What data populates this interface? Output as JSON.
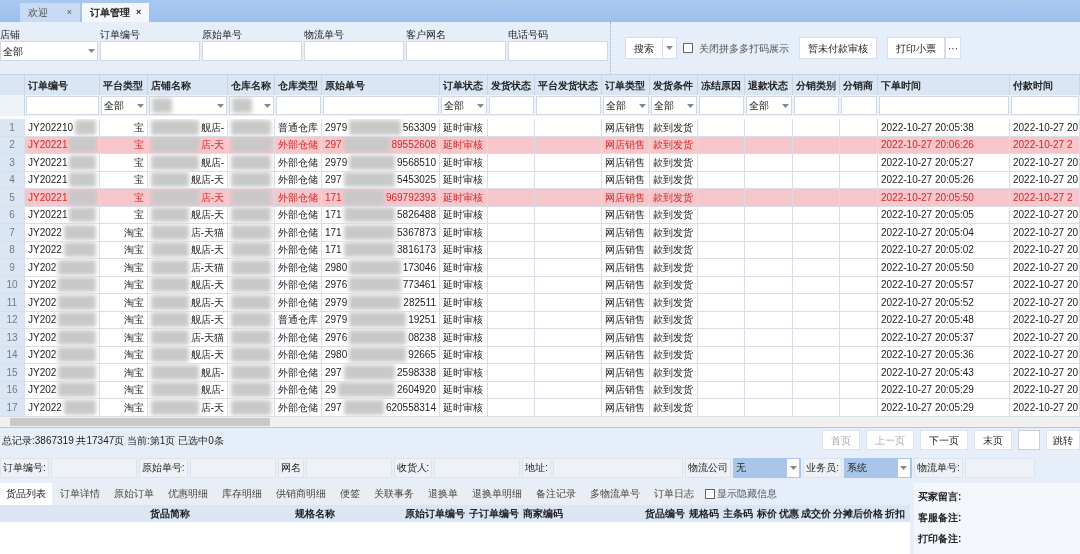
{
  "tabs": [
    {
      "label": "欢迎",
      "close": "×",
      "selected": false
    },
    {
      "label": "订单管理",
      "close": "×",
      "selected": true
    }
  ],
  "search": {
    "fields": [
      {
        "label": "店铺",
        "value": "全部",
        "kind": "select"
      },
      {
        "label": "订单编号",
        "kind": "text"
      },
      {
        "label": "原始单号",
        "kind": "text"
      },
      {
        "label": "物流单号",
        "kind": "text"
      },
      {
        "label": "客户网名",
        "kind": "text"
      },
      {
        "label": "电话号码",
        "kind": "text"
      }
    ],
    "search_button": "搜索",
    "checkbox": {
      "label": "关闭拼多多打码展示",
      "checked": false
    },
    "buttons": [
      "暂未付款审核",
      "打印小票"
    ],
    "more": "···"
  },
  "grid": {
    "columns": [
      {
        "label": "订单编号",
        "filter": {
          "kind": "text"
        }
      },
      {
        "label": "平台类型",
        "filter": {
          "kind": "select",
          "value": "全部"
        }
      },
      {
        "label": "店铺名称",
        "filter": {
          "kind": "select"
        }
      },
      {
        "label": "仓库名称",
        "filter": {
          "kind": "select"
        }
      },
      {
        "label": "仓库类型",
        "filter": {
          "kind": "text"
        }
      },
      {
        "label": "原始单号",
        "filter": {
          "kind": "text"
        }
      },
      {
        "label": "订单状态",
        "filter": {
          "kind": "select",
          "value": "全部"
        }
      },
      {
        "label": "发货状态",
        "filter": {
          "kind": "text"
        }
      },
      {
        "label": "平台发货状态",
        "filter": {
          "kind": "text"
        }
      },
      {
        "label": "订单类型",
        "filter": {
          "kind": "select",
          "value": "全部"
        }
      },
      {
        "label": "发货条件",
        "filter": {
          "kind": "select",
          "value": "全部"
        }
      },
      {
        "label": "冻结原因",
        "filter": {
          "kind": "text"
        }
      },
      {
        "label": "退款状态",
        "filter": {
          "kind": "select",
          "value": "全部"
        }
      },
      {
        "label": "分销类别",
        "filter": {
          "kind": "text"
        }
      },
      {
        "label": "分销商",
        "filter": {
          "kind": "text"
        }
      },
      {
        "label": "下单时间",
        "filter": {
          "kind": "text"
        }
      },
      {
        "label": "付款时间",
        "filter": {
          "kind": "text"
        }
      }
    ],
    "rows": [
      {
        "index": "1",
        "order_no": "JY202210",
        "platform": "宝",
        "shop": "舰店-",
        "warehouse_type": "普通仓库",
        "orig_a": "2979",
        "orig_b": "563309",
        "status": "延时审核",
        "order_type": "网店销售",
        "condition": "款到发货",
        "order_time": "2022-10-27 20:05:38",
        "pay_time": "2022-10-27 20",
        "highlighted": false
      },
      {
        "index": "2",
        "order_no": "JY20221",
        "platform": "宝",
        "shop": "店-天",
        "warehouse_type": "外部仓储",
        "orig_a": "297",
        "orig_b": "89552608",
        "status": "延时审核",
        "order_type": "网店销售",
        "condition": "款到发货",
        "order_time": "2022-10-27 20:06:26",
        "pay_time": "2022-10-27 2",
        "highlighted": true
      },
      {
        "index": "3",
        "order_no": "JY20221",
        "platform": "宝",
        "shop": "舰店-",
        "warehouse_type": "外部仓储",
        "orig_a": "2979",
        "orig_b": "9568510",
        "status": "延时审核",
        "order_type": "网店销售",
        "condition": "款到发货",
        "order_time": "2022-10-27 20:05:27",
        "pay_time": "2022-10-27 20",
        "highlighted": false
      },
      {
        "index": "4",
        "order_no": "JY20221",
        "platform": "宝",
        "shop": "舰店-天",
        "warehouse_type": "外部仓储",
        "orig_a": "297",
        "orig_b": "5453025",
        "status": "延时审核",
        "order_type": "网店销售",
        "condition": "款到发货",
        "order_time": "2022-10-27 20:05:26",
        "pay_time": "2022-10-27 20",
        "highlighted": false
      },
      {
        "index": "5",
        "order_no": "JY20221",
        "platform": "宝",
        "shop": "店-天",
        "warehouse_type": "外部仓储",
        "orig_a": "171",
        "orig_b": "969792393",
        "status": "延时审核",
        "order_type": "网店销售",
        "condition": "款到发货",
        "order_time": "2022-10-27 20:05:50",
        "pay_time": "2022-10-27 2",
        "highlighted": true
      },
      {
        "index": "6",
        "order_no": "JY20221",
        "platform": "宝",
        "shop": "舰店-天",
        "warehouse_type": "外部仓储",
        "orig_a": "171",
        "orig_b": "5826488",
        "status": "延时审核",
        "order_type": "网店销售",
        "condition": "款到发货",
        "order_time": "2022-10-27 20:05:05",
        "pay_time": "2022-10-27 20",
        "highlighted": false
      },
      {
        "index": "7",
        "order_no": "JY2022",
        "platform": "淘宝",
        "shop": "店-天猫",
        "warehouse_type": "外部仓储",
        "orig_a": "171",
        "orig_b": "5367873",
        "status": "延时审核",
        "order_type": "网店销售",
        "condition": "款到发货",
        "order_time": "2022-10-27 20:05:04",
        "pay_time": "2022-10-27 20",
        "highlighted": false
      },
      {
        "index": "8",
        "order_no": "JY2022",
        "platform": "淘宝",
        "shop": "舰店-天",
        "warehouse_type": "外部仓储",
        "orig_a": "171",
        "orig_b": "3816173",
        "status": "延时审核",
        "order_type": "网店销售",
        "condition": "款到发货",
        "order_time": "2022-10-27 20:05:02",
        "pay_time": "2022-10-27 20",
        "highlighted": false
      },
      {
        "index": "9",
        "order_no": "JY202",
        "platform": "淘宝",
        "shop": "店-天猫",
        "warehouse_type": "外部仓储",
        "orig_a": "2980",
        "orig_b": "173046",
        "status": "延时审核",
        "order_type": "网店销售",
        "condition": "款到发货",
        "order_time": "2022-10-27 20:05:50",
        "pay_time": "2022-10-27 20",
        "highlighted": false
      },
      {
        "index": "10",
        "order_no": "JY202",
        "platform": "淘宝",
        "shop": "舰店-天",
        "warehouse_type": "外部仓储",
        "orig_a": "2976",
        "orig_b": "773461",
        "status": "延时审核",
        "order_type": "网店销售",
        "condition": "款到发货",
        "order_time": "2022-10-27 20:05:57",
        "pay_time": "2022-10-27 20",
        "highlighted": false
      },
      {
        "index": "11",
        "order_no": "JY202",
        "platform": "淘宝",
        "shop": "舰店-天",
        "warehouse_type": "外部仓储",
        "orig_a": "2979",
        "orig_b": "282511",
        "status": "延时审核",
        "order_type": "网店销售",
        "condition": "款到发货",
        "order_time": "2022-10-27 20:05:52",
        "pay_time": "2022-10-27 20",
        "highlighted": false
      },
      {
        "index": "12",
        "order_no": "JY202",
        "platform": "淘宝",
        "shop": "舰店-天",
        "warehouse_type": "普通仓库",
        "orig_a": "2979",
        "orig_b": "19251",
        "status": "延时审核",
        "order_type": "网店销售",
        "condition": "款到发货",
        "order_time": "2022-10-27 20:05:48",
        "pay_time": "2022-10-27 20",
        "highlighted": false
      },
      {
        "index": "13",
        "order_no": "JY202",
        "platform": "淘宝",
        "shop": "店-天猫",
        "warehouse_type": "外部仓储",
        "orig_a": "2976",
        "orig_b": "08238",
        "status": "延时审核",
        "order_type": "网店销售",
        "condition": "款到发货",
        "order_time": "2022-10-27 20:05:37",
        "pay_time": "2022-10-27 20",
        "highlighted": false
      },
      {
        "index": "14",
        "order_no": "JY202",
        "platform": "淘宝",
        "shop": "舰店-天",
        "warehouse_type": "外部仓储",
        "orig_a": "2980",
        "orig_b": "92665",
        "status": "延时审核",
        "order_type": "网店销售",
        "condition": "款到发货",
        "order_time": "2022-10-27 20:05:36",
        "pay_time": "2022-10-27 20",
        "highlighted": false
      },
      {
        "index": "15",
        "order_no": "JY202",
        "platform": "淘宝",
        "shop": "舰店-",
        "warehouse_type": "外部仓储",
        "orig_a": "297",
        "orig_b": "2598338",
        "status": "延时审核",
        "order_type": "网店销售",
        "condition": "款到发货",
        "order_time": "2022-10-27 20:05:43",
        "pay_time": "2022-10-27 20",
        "highlighted": false
      },
      {
        "index": "16",
        "order_no": "JY202",
        "platform": "淘宝",
        "shop": "舰店-",
        "warehouse_type": "外部仓储",
        "orig_a": "29",
        "orig_b": "2604920",
        "status": "延时审核",
        "order_type": "网店销售",
        "condition": "款到发货",
        "order_time": "2022-10-27 20:05:29",
        "pay_time": "2022-10-27 20",
        "highlighted": false
      },
      {
        "index": "17",
        "order_no": "JY2022",
        "platform": "淘宝",
        "shop": "店-天",
        "warehouse_type": "外部仓储",
        "orig_a": "297",
        "orig_b": "620558314",
        "status": "延时审核",
        "order_type": "网店销售",
        "condition": "款到发货",
        "order_time": "2022-10-27 20:05:29",
        "pay_time": "2022-10-27 20",
        "highlighted": false
      }
    ]
  },
  "status_bar": {
    "summary": "总记录:3867319 共17347页 当前:第1页 已选中0条",
    "pager": [
      {
        "label": "首页",
        "disabled": true
      },
      {
        "label": "上一页",
        "disabled": true
      },
      {
        "label": "下一页",
        "disabled": false
      },
      {
        "label": "末页",
        "disabled": false
      }
    ],
    "jump": "跳转"
  },
  "detail": [
    {
      "label": "订单编号:",
      "kind": "text"
    },
    {
      "label": "原始单号:",
      "kind": "text"
    },
    {
      "label": "网名",
      "kind": "text"
    },
    {
      "label": "收货人:",
      "kind": "text"
    },
    {
      "label": "地址:",
      "kind": "text"
    },
    {
      "label": "物流公司",
      "kind": "select",
      "value": "无"
    },
    {
      "label": "业务员:",
      "kind": "select",
      "value": "系统"
    },
    {
      "label": "物流单号:",
      "kind": "text"
    }
  ],
  "bottom_tabs": [
    {
      "label": "货品列表",
      "selected": true
    },
    {
      "label": "订单详情",
      "selected": false
    },
    {
      "label": "原始订单",
      "selected": false
    },
    {
      "label": "优惠明细",
      "selected": false
    },
    {
      "label": "库存明细",
      "selected": false
    },
    {
      "label": "供销商明细",
      "selected": false
    },
    {
      "label": "便签",
      "selected": false
    },
    {
      "label": "关联事务",
      "selected": false
    },
    {
      "label": "退换单",
      "selected": false
    },
    {
      "label": "退换单明细",
      "selected": false
    },
    {
      "label": "备注记录",
      "selected": false
    },
    {
      "label": "多物流单号",
      "selected": false
    },
    {
      "label": "订单日志",
      "selected": false
    }
  ],
  "show_hidden": {
    "label": "显示隐藏信息",
    "checked": false
  },
  "items_columns": [
    "货品简称",
    "规格名称",
    "原始订单编号",
    "子订单编号",
    "商家编码",
    "货品编号",
    "规格码",
    "主条码",
    "标价",
    "优惠",
    "成交价",
    "分摊后价格",
    "折扣"
  ],
  "notes": [
    "买家留言:",
    "客服备注:",
    "打印备注:"
  ]
}
